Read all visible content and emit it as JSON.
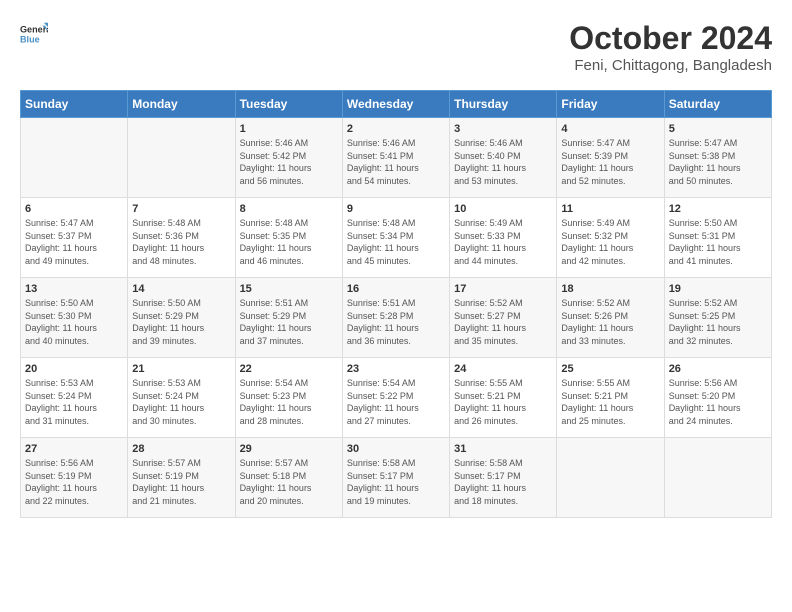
{
  "logo": {
    "line1": "General",
    "line2": "Blue"
  },
  "title": "October 2024",
  "subtitle": "Feni, Chittagong, Bangladesh",
  "weekdays": [
    "Sunday",
    "Monday",
    "Tuesday",
    "Wednesday",
    "Thursday",
    "Friday",
    "Saturday"
  ],
  "weeks": [
    [
      {
        "day": "",
        "info": ""
      },
      {
        "day": "",
        "info": ""
      },
      {
        "day": "1",
        "info": "Sunrise: 5:46 AM\nSunset: 5:42 PM\nDaylight: 11 hours\nand 56 minutes."
      },
      {
        "day": "2",
        "info": "Sunrise: 5:46 AM\nSunset: 5:41 PM\nDaylight: 11 hours\nand 54 minutes."
      },
      {
        "day": "3",
        "info": "Sunrise: 5:46 AM\nSunset: 5:40 PM\nDaylight: 11 hours\nand 53 minutes."
      },
      {
        "day": "4",
        "info": "Sunrise: 5:47 AM\nSunset: 5:39 PM\nDaylight: 11 hours\nand 52 minutes."
      },
      {
        "day": "5",
        "info": "Sunrise: 5:47 AM\nSunset: 5:38 PM\nDaylight: 11 hours\nand 50 minutes."
      }
    ],
    [
      {
        "day": "6",
        "info": "Sunrise: 5:47 AM\nSunset: 5:37 PM\nDaylight: 11 hours\nand 49 minutes."
      },
      {
        "day": "7",
        "info": "Sunrise: 5:48 AM\nSunset: 5:36 PM\nDaylight: 11 hours\nand 48 minutes."
      },
      {
        "day": "8",
        "info": "Sunrise: 5:48 AM\nSunset: 5:35 PM\nDaylight: 11 hours\nand 46 minutes."
      },
      {
        "day": "9",
        "info": "Sunrise: 5:48 AM\nSunset: 5:34 PM\nDaylight: 11 hours\nand 45 minutes."
      },
      {
        "day": "10",
        "info": "Sunrise: 5:49 AM\nSunset: 5:33 PM\nDaylight: 11 hours\nand 44 minutes."
      },
      {
        "day": "11",
        "info": "Sunrise: 5:49 AM\nSunset: 5:32 PM\nDaylight: 11 hours\nand 42 minutes."
      },
      {
        "day": "12",
        "info": "Sunrise: 5:50 AM\nSunset: 5:31 PM\nDaylight: 11 hours\nand 41 minutes."
      }
    ],
    [
      {
        "day": "13",
        "info": "Sunrise: 5:50 AM\nSunset: 5:30 PM\nDaylight: 11 hours\nand 40 minutes."
      },
      {
        "day": "14",
        "info": "Sunrise: 5:50 AM\nSunset: 5:29 PM\nDaylight: 11 hours\nand 39 minutes."
      },
      {
        "day": "15",
        "info": "Sunrise: 5:51 AM\nSunset: 5:29 PM\nDaylight: 11 hours\nand 37 minutes."
      },
      {
        "day": "16",
        "info": "Sunrise: 5:51 AM\nSunset: 5:28 PM\nDaylight: 11 hours\nand 36 minutes."
      },
      {
        "day": "17",
        "info": "Sunrise: 5:52 AM\nSunset: 5:27 PM\nDaylight: 11 hours\nand 35 minutes."
      },
      {
        "day": "18",
        "info": "Sunrise: 5:52 AM\nSunset: 5:26 PM\nDaylight: 11 hours\nand 33 minutes."
      },
      {
        "day": "19",
        "info": "Sunrise: 5:52 AM\nSunset: 5:25 PM\nDaylight: 11 hours\nand 32 minutes."
      }
    ],
    [
      {
        "day": "20",
        "info": "Sunrise: 5:53 AM\nSunset: 5:24 PM\nDaylight: 11 hours\nand 31 minutes."
      },
      {
        "day": "21",
        "info": "Sunrise: 5:53 AM\nSunset: 5:24 PM\nDaylight: 11 hours\nand 30 minutes."
      },
      {
        "day": "22",
        "info": "Sunrise: 5:54 AM\nSunset: 5:23 PM\nDaylight: 11 hours\nand 28 minutes."
      },
      {
        "day": "23",
        "info": "Sunrise: 5:54 AM\nSunset: 5:22 PM\nDaylight: 11 hours\nand 27 minutes."
      },
      {
        "day": "24",
        "info": "Sunrise: 5:55 AM\nSunset: 5:21 PM\nDaylight: 11 hours\nand 26 minutes."
      },
      {
        "day": "25",
        "info": "Sunrise: 5:55 AM\nSunset: 5:21 PM\nDaylight: 11 hours\nand 25 minutes."
      },
      {
        "day": "26",
        "info": "Sunrise: 5:56 AM\nSunset: 5:20 PM\nDaylight: 11 hours\nand 24 minutes."
      }
    ],
    [
      {
        "day": "27",
        "info": "Sunrise: 5:56 AM\nSunset: 5:19 PM\nDaylight: 11 hours\nand 22 minutes."
      },
      {
        "day": "28",
        "info": "Sunrise: 5:57 AM\nSunset: 5:19 PM\nDaylight: 11 hours\nand 21 minutes."
      },
      {
        "day": "29",
        "info": "Sunrise: 5:57 AM\nSunset: 5:18 PM\nDaylight: 11 hours\nand 20 minutes."
      },
      {
        "day": "30",
        "info": "Sunrise: 5:58 AM\nSunset: 5:17 PM\nDaylight: 11 hours\nand 19 minutes."
      },
      {
        "day": "31",
        "info": "Sunrise: 5:58 AM\nSunset: 5:17 PM\nDaylight: 11 hours\nand 18 minutes."
      },
      {
        "day": "",
        "info": ""
      },
      {
        "day": "",
        "info": ""
      }
    ]
  ]
}
